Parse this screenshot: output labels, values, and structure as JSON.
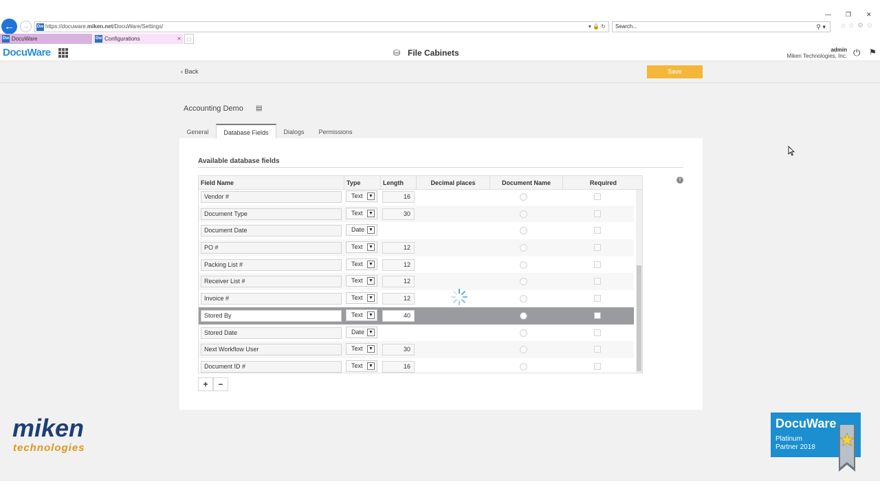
{
  "browser": {
    "url_prefix": "https://docuware.",
    "url_host": "miken.net",
    "url_path": "/DocuWare/Settings/",
    "search_placeholder": "Search...",
    "tabs": [
      {
        "label": "DocuWare"
      },
      {
        "label": "Configurations"
      }
    ],
    "favicon_text": "Dw"
  },
  "app": {
    "logo": "DocuWare",
    "title": "File Cabinets",
    "user_name": "admin",
    "user_org": "Miken Technologies, Inc."
  },
  "toolbar": {
    "back_label": "Back",
    "save_label": "Save"
  },
  "cabinet": {
    "name": "Accounting Demo",
    "tabs": [
      {
        "label": "General"
      },
      {
        "label": "Database Fields"
      },
      {
        "label": "Dialogs"
      },
      {
        "label": "Permissions"
      }
    ],
    "active_tab": "Database Fields"
  },
  "fields_section": {
    "title": "Available database fields",
    "columns": {
      "field_name": "Field Name",
      "type": "Type",
      "length": "Length",
      "decimal_places": "Decimal places",
      "document_name": "Document Name",
      "required": "Required"
    },
    "rows": [
      {
        "name": "Vendor #",
        "type": "Text",
        "length": "16"
      },
      {
        "name": "Document Type",
        "type": "Text",
        "length": "30"
      },
      {
        "name": "Document Date",
        "type": "Date",
        "length": ""
      },
      {
        "name": "PO #",
        "type": "Text",
        "length": "12"
      },
      {
        "name": "Packing List #",
        "type": "Text",
        "length": "12"
      },
      {
        "name": "Receiver List #",
        "type": "Text",
        "length": "12"
      },
      {
        "name": "Invoice #",
        "type": "Text",
        "length": "12"
      },
      {
        "name": "Stored By",
        "type": "Text",
        "length": "40",
        "selected": true
      },
      {
        "name": "Stored Date",
        "type": "Date",
        "length": ""
      },
      {
        "name": "Next Workflow User",
        "type": "Text",
        "length": "30"
      },
      {
        "name": "Document ID #",
        "type": "Text",
        "length": "16"
      }
    ],
    "add_label": "+",
    "remove_label": "−"
  },
  "branding": {
    "miken_line1": "miken",
    "miken_line2": "technologies",
    "partner_logo": "DocuWare",
    "partner_line1": "Platinum",
    "partner_line2": "Partner 2018"
  },
  "colors": {
    "accent_blue": "#2a8ed6",
    "save_orange": "#f4b73a",
    "selected_row": "#999b9e",
    "miken_navy": "#1f3f73",
    "miken_orange": "#e2951f",
    "partner_blue": "#1b8fd0"
  },
  "icons": {
    "back": "arrow-left-icon",
    "apps": "grid-icon",
    "database": "database-icon",
    "power": "power-icon",
    "announce": "megaphone-icon",
    "info": "info-icon",
    "comment": "comment-icon",
    "spinner": "loading-spinner-icon"
  }
}
